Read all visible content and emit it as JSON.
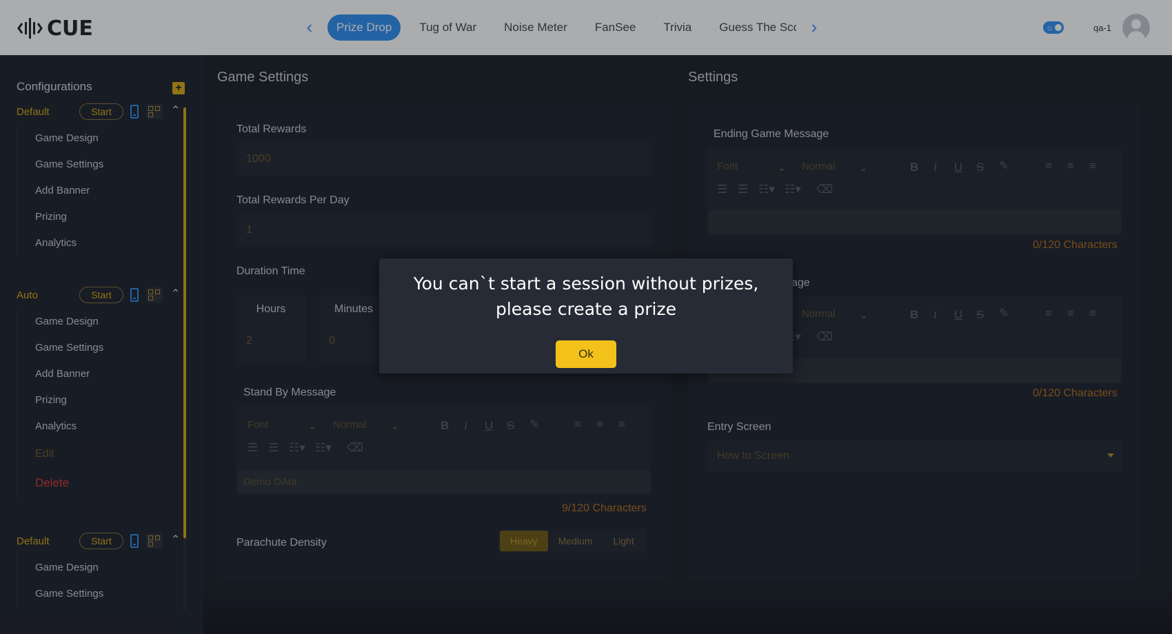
{
  "app": {
    "logo_text": "CUE",
    "brand_color": "#2f8ff0",
    "accent_color": "#d8a814"
  },
  "header": {
    "tabs": [
      {
        "label": "Prize Drop",
        "active": true
      },
      {
        "label": "Tug of War"
      },
      {
        "label": "Noise Meter"
      },
      {
        "label": "FanSee"
      },
      {
        "label": "Trivia"
      },
      {
        "label": "Guess The Sco"
      }
    ],
    "prev_icon": "chevron-left-icon",
    "next_icon": "chevron-right-icon",
    "theme_toggle_icon": "sun-icon",
    "username": "qa-1",
    "avatar_icon": "user-avatar-icon"
  },
  "sidebar": {
    "title": "Configurations",
    "add_icon": "plus-icon",
    "groups": [
      {
        "name": "Default",
        "start_label": "Start",
        "items": [
          "Game Design",
          "Game Settings",
          "Add Banner",
          "Prizing",
          "Analytics"
        ]
      },
      {
        "name": "Auto",
        "start_label": "Start",
        "items": [
          "Game Design",
          "Game Settings",
          "Add Banner",
          "Prizing",
          "Analytics"
        ],
        "edit_label": "Edit",
        "delete_label": "Delete"
      },
      {
        "name": "Default",
        "start_label": "Start",
        "items": [
          "Game Design",
          "Game Settings"
        ]
      }
    ]
  },
  "game_settings": {
    "title": "Game Settings",
    "total_rewards_label": "Total Rewards",
    "total_rewards_value": "1000",
    "per_day_label": "Total Rewards Per Day",
    "per_day_value": "1",
    "duration_label": "Duration Time",
    "hours_label": "Hours",
    "hours_value": "2",
    "minutes_label": "Minutes",
    "minutes_value": "0",
    "standby_label": "Stand By Message",
    "standby_text": "Demo DAta",
    "standby_counter": "9/120 Characters",
    "density_label": "Parachute Density",
    "density_options": [
      "Heavy",
      "Medium",
      "Light"
    ],
    "density_selected": "Heavy"
  },
  "editor": {
    "font_label": "Font",
    "size_label": "Normal"
  },
  "settings": {
    "title": "Settings",
    "ending_label": "Ending Game Message",
    "ending_counter": "0/120 Characters",
    "second_label_partial": "age",
    "second_counter": "0/120 Characters",
    "entry_label": "Entry Screen",
    "entry_value": "How to Screen"
  },
  "modal": {
    "message": "You can`t start a session without prizes, please create a prize",
    "ok_label": "Ok"
  }
}
